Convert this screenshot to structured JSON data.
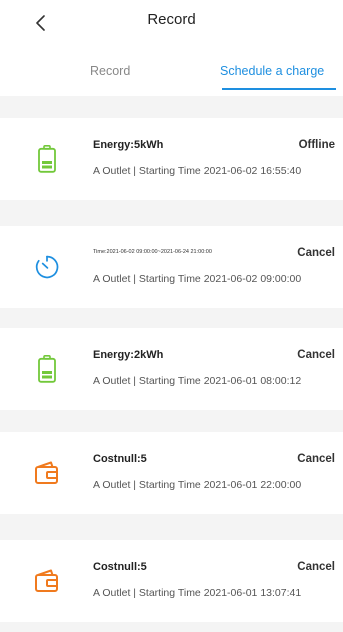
{
  "header": {
    "title": "Record",
    "back_icon": "chevron-left-icon"
  },
  "tabs": {
    "record": "Record",
    "schedule": "Schedule a charge",
    "active": "schedule",
    "accent_color": "#1e8fe0"
  },
  "records": [
    {
      "icon": "battery-icon",
      "icon_color": "#72c83a",
      "main": "Energy:5kWh",
      "status": "Offline",
      "sub": "A Outlet | Starting Time 2021-06-02 16:55:40"
    },
    {
      "icon": "timer-icon",
      "icon_color": "#1e8fe0",
      "main": "Time:2021-06-02 09:00:00~2021-06-24 21:00:00",
      "status": "Cancel",
      "sub": "A Outlet | Starting Time 2021-06-02 09:00:00"
    },
    {
      "icon": "battery-icon",
      "icon_color": "#72c83a",
      "main": "Energy:2kWh",
      "status": "Cancel",
      "sub": "A Outlet | Starting Time 2021-06-01 08:00:12"
    },
    {
      "icon": "wallet-icon",
      "icon_color": "#f07a1e",
      "main": "Costnull:5",
      "status": "Cancel",
      "sub": "A Outlet | Starting Time 2021-06-01 22:00:00"
    },
    {
      "icon": "wallet-icon",
      "icon_color": "#f07a1e",
      "main": "Costnull:5",
      "status": "Cancel",
      "sub": "A Outlet | Starting Time 2021-06-01 13:07:41"
    }
  ]
}
